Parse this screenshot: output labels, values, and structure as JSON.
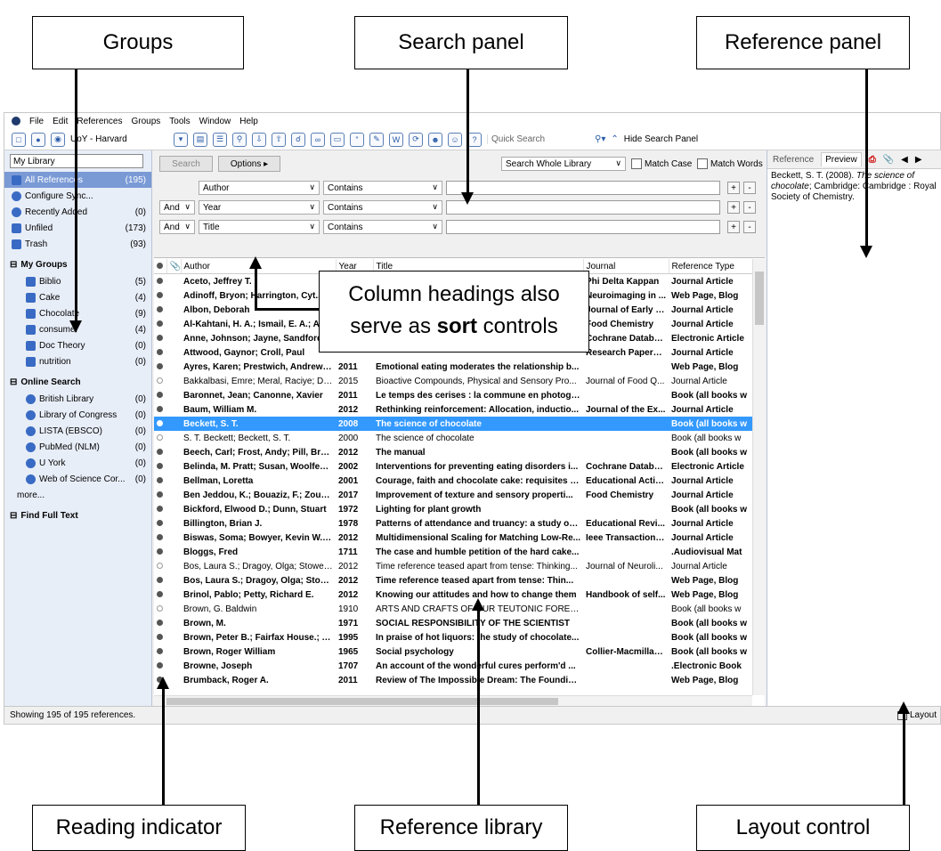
{
  "callouts": {
    "groups": "Groups",
    "search_panel": "Search panel",
    "reference_panel": "Reference panel",
    "column_headings_line1": "Column headings also",
    "column_headings_line2_prefix": "serve as ",
    "column_headings_line2_bold": "sort",
    "column_headings_line2_suffix": " controls",
    "reading_indicator": "Reading indicator",
    "reference_library": "Reference library",
    "layout_control": "Layout control"
  },
  "menu": [
    "File",
    "Edit",
    "References",
    "Groups",
    "Tools",
    "Window",
    "Help"
  ],
  "toolbar": {
    "style": "UoY - Harvard",
    "quick_search_placeholder": "Quick Search",
    "hide_search": "Hide Search Panel"
  },
  "left": {
    "library_box": "My Library",
    "groups": [
      {
        "label": "All References",
        "count": "(195)",
        "selected": true
      },
      {
        "label": "Configure Sync...",
        "count": ""
      },
      {
        "label": "Recently Added",
        "count": "(0)"
      },
      {
        "label": "Unfiled",
        "count": "(173)"
      },
      {
        "label": "Trash",
        "count": "(93)"
      }
    ],
    "my_groups_title": "My Groups",
    "my_groups": [
      {
        "label": "Biblio",
        "count": "(5)"
      },
      {
        "label": "Cake",
        "count": "(4)"
      },
      {
        "label": "Chocolate",
        "count": "(9)"
      },
      {
        "label": "consumer",
        "count": "(4)"
      },
      {
        "label": "Doc Theory",
        "count": "(0)"
      },
      {
        "label": "nutrition",
        "count": "(0)"
      }
    ],
    "online_title": "Online Search",
    "online": [
      {
        "label": "British Library",
        "count": "(0)"
      },
      {
        "label": "Library of Congress",
        "count": "(0)"
      },
      {
        "label": "LISTA (EBSCO)",
        "count": "(0)"
      },
      {
        "label": "PubMed (NLM)",
        "count": "(0)"
      },
      {
        "label": "U York",
        "count": "(0)"
      },
      {
        "label": "Web of Science Cor...",
        "count": "(0)"
      }
    ],
    "more": "more...",
    "find_full_text": "Find Full Text"
  },
  "search": {
    "search_btn": "Search",
    "options_btn": "Options ▸",
    "scope": "Search Whole Library",
    "match_case": "Match Case",
    "match_words": "Match Words",
    "rows": [
      {
        "bool": "",
        "field": "Author",
        "op": "Contains"
      },
      {
        "bool": "And",
        "field": "Year",
        "op": "Contains"
      },
      {
        "bool": "And",
        "field": "Title",
        "op": "Contains"
      }
    ]
  },
  "table": {
    "headers": [
      "Author",
      "Year",
      "Title",
      "Journal",
      "Reference Type"
    ],
    "rows": [
      {
        "read": false,
        "author": "Aceto, Jeffrey T.",
        "year": "",
        "title": "",
        "journal": "Phi Delta Kappan",
        "type": "Journal Article"
      },
      {
        "read": false,
        "author": "Adinoff, Bryon; Harrington, Cyt...",
        "year": "",
        "title": "",
        "journal": "Neuroimaging in ...",
        "type": "Web Page, Blog"
      },
      {
        "read": false,
        "author": "Albon, Deborah",
        "year": "",
        "title": "",
        "journal": "Journal of Early C...",
        "type": "Journal Article"
      },
      {
        "read": false,
        "author": "Al-Kahtani, H. A.; Ismail, E. A.; A...",
        "year": "",
        "title": "",
        "journal": "Food Chemistry",
        "type": "Journal Article"
      },
      {
        "read": false,
        "author": "Anne, Johnson; Jayne, Sandford...",
        "year": "",
        "title": "",
        "journal": "Cochrane Databa...",
        "type": "Electronic Article"
      },
      {
        "read": false,
        "author": "Attwood, Gaynor; Croll, Paul",
        "year": "",
        "title": "",
        "journal": "Research Papers ...",
        "type": "Journal Article"
      },
      {
        "read": false,
        "author": "Ayres, Karen; Prestwich, Andrew; ...",
        "year": "2011",
        "title": "Emotional eating moderates the relationship b...",
        "journal": "",
        "type": "Web Page, Blog"
      },
      {
        "read": true,
        "author": "Bakkalbasi, Emre; Meral, Raciye; Dog...",
        "year": "2015",
        "title": "Bioactive Compounds, Physical and Sensory Pro...",
        "journal": "Journal of Food Q...",
        "type": "Journal Article"
      },
      {
        "read": false,
        "author": "Baronnet, Jean; Canonne, Xavier",
        "year": "2011",
        "title": "Le temps des cerises : la commune en photogr...",
        "journal": "",
        "type": "Book (all books w"
      },
      {
        "read": false,
        "author": "Baum, William M.",
        "year": "2012",
        "title": "Rethinking reinforcement: Allocation, inductio...",
        "journal": "Journal of the Ex...",
        "type": "Journal Article"
      },
      {
        "read": false,
        "selected": true,
        "author": "Beckett, S. T.",
        "year": "2008",
        "title": "The science of chocolate",
        "journal": "",
        "type": "Book (all books w"
      },
      {
        "read": true,
        "author": "S. T. Beckett; Beckett, S. T.",
        "year": "2000",
        "title": "The science of chocolate",
        "journal": "",
        "type": "Book (all books w"
      },
      {
        "read": false,
        "author": "Beech, Carl; Frost, Andy; Pill, Bryan;...",
        "year": "2012",
        "title": "The manual",
        "journal": "",
        "type": "Book (all books w"
      },
      {
        "read": false,
        "author": "Belinda, M. Pratt; Susan, Woolfend...",
        "year": "2002",
        "title": "Interventions for preventing eating disorders i...",
        "journal": "Cochrane Databa...",
        "type": "Electronic Article"
      },
      {
        "read": false,
        "author": "Bellman, Loretta",
        "year": "2001",
        "title": "Courage, faith and chocolate cake: requisites f...",
        "journal": "Educational Actio...",
        "type": "Journal Article"
      },
      {
        "read": false,
        "author": "Ben Jeddou, K.; Bouaziz, F.; Zouari-...",
        "year": "2017",
        "title": "Improvement of texture and sensory properti...",
        "journal": "Food Chemistry",
        "type": "Journal Article"
      },
      {
        "read": false,
        "author": "Bickford, Elwood D.; Dunn, Stuart",
        "year": "1972",
        "title": "Lighting for plant growth",
        "journal": "",
        "type": "Book (all books w"
      },
      {
        "read": false,
        "author": "Billington, Brian J.",
        "year": "1978",
        "title": "Patterns of attendance and truancy: a study of ...",
        "journal": "Educational Revi...",
        "type": "Journal Article"
      },
      {
        "read": false,
        "author": "Biswas, Soma; Bowyer, Kevin W.; Fl...",
        "year": "2012",
        "title": "Multidimensional Scaling for Matching Low-Re...",
        "journal": "Ieee Transactions...",
        "type": "Journal Article"
      },
      {
        "read": false,
        "author": "Bloggs, Fred",
        "year": "1711",
        "title": "The case and humble petition of the hard cake...",
        "journal": "",
        "type": ".Audiovisual Mat"
      },
      {
        "read": true,
        "author": "Bos, Laura S.; Dragoy, Olga; Stowe, L...",
        "year": "2012",
        "title": "Time reference teased apart from tense: Thinking...",
        "journal": "Journal of Neuroli...",
        "type": "Journal Article"
      },
      {
        "read": false,
        "author": "Bos, Laura S.; Dragoy, Olga; Stowe, ...",
        "year": "2012",
        "title": "Time reference teased apart from tense: Thin...",
        "journal": "",
        "type": "Web Page, Blog"
      },
      {
        "read": false,
        "author": "Brinol, Pablo; Petty, Richard E.",
        "year": "2012",
        "title": "Knowing our attitudes and how to change them",
        "journal": "Handbook of self...",
        "type": "Web Page, Blog"
      },
      {
        "read": true,
        "author": "Brown, G. Baldwin",
        "year": "1910",
        "title": "ARTS AND CRAFTS OF OUR TEUTONIC FOREFAT...",
        "journal": "",
        "type": "Book (all books w"
      },
      {
        "read": false,
        "author": "Brown, M.",
        "year": "1971",
        "title": "SOCIAL RESPONSIBILITY OF THE SCIENTIST",
        "journal": "",
        "type": "Book (all books w"
      },
      {
        "read": false,
        "author": "Brown, Peter B.; Fairfax House.; Y...",
        "year": "1995",
        "title": "In praise of hot liquors: the study of chocolate...",
        "journal": "",
        "type": "Book (all books w"
      },
      {
        "read": false,
        "author": "Brown, Roger William",
        "year": "1965",
        "title": "Social psychology",
        "journal": "Collier-Macmillan...",
        "type": "Book (all books w"
      },
      {
        "read": false,
        "author": "Browne, Joseph",
        "year": "1707",
        "title": "An account of the wonderful cures perform'd ...",
        "journal": "",
        "type": ".Electronic Book"
      },
      {
        "read": false,
        "author": "Brumback, Roger A.",
        "year": "2011",
        "title": "Review of The Impossible Dream: The Foundin...",
        "journal": "",
        "type": "Web Page, Blog"
      }
    ]
  },
  "reference_panel": {
    "tab_reference": "Reference",
    "tab_preview": "Preview",
    "preview_plain": "Beckett, S. T. (2008). ",
    "preview_italic": "The science of chocolate",
    "preview_rest": "; Cambridge: Cambridge : Royal Society of Chemistry."
  },
  "status": {
    "text": "Showing 195 of 195 references.",
    "layout": "Layout"
  }
}
